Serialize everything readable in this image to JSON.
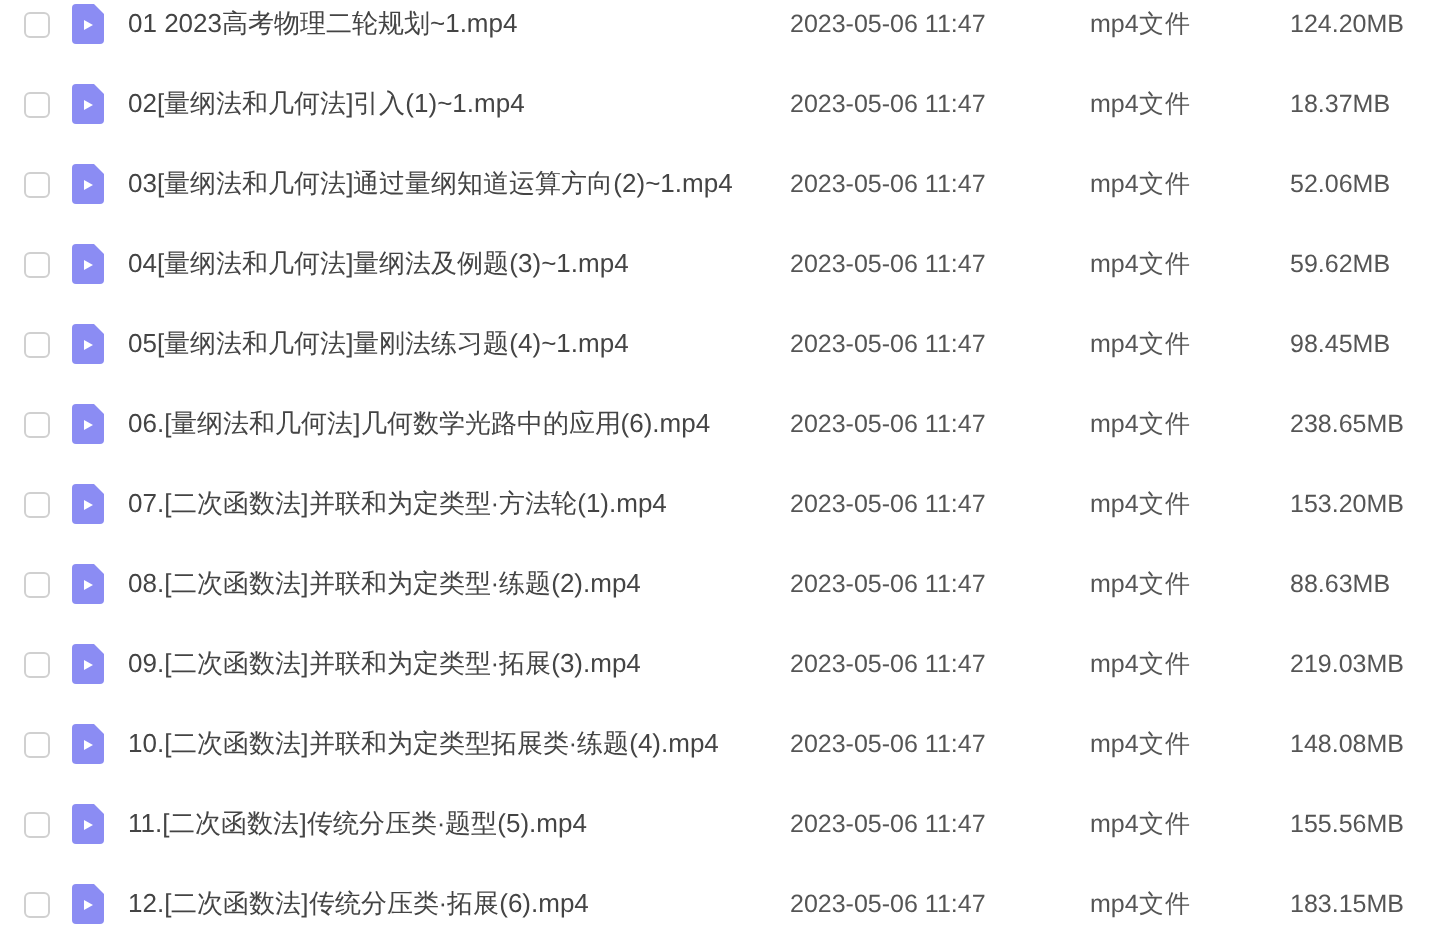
{
  "files": [
    {
      "name": "01 2023高考物理二轮规划~1.mp4",
      "modified": "2023-05-06 11:47",
      "type": "mp4文件",
      "size": "124.20MB",
      "checked": false
    },
    {
      "name": "02[量纲法和几何法]引入(1)~1.mp4",
      "modified": "2023-05-06 11:47",
      "type": "mp4文件",
      "size": "18.37MB",
      "checked": false
    },
    {
      "name": "03[量纲法和几何法]通过量纲知道运算方向(2)~1.mp4",
      "modified": "2023-05-06 11:47",
      "type": "mp4文件",
      "size": "52.06MB",
      "checked": false
    },
    {
      "name": "04[量纲法和几何法]量纲法及例题(3)~1.mp4",
      "modified": "2023-05-06 11:47",
      "type": "mp4文件",
      "size": "59.62MB",
      "checked": false
    },
    {
      "name": "05[量纲法和几何法]量刚法练习题(4)~1.mp4",
      "modified": "2023-05-06 11:47",
      "type": "mp4文件",
      "size": "98.45MB",
      "checked": false
    },
    {
      "name": "06.[量纲法和几何法]几何数学光路中的应用(6).mp4",
      "modified": "2023-05-06 11:47",
      "type": "mp4文件",
      "size": "238.65MB",
      "checked": false
    },
    {
      "name": "07.[二次函数法]并联和为定类型·方法轮(1).mp4",
      "modified": "2023-05-06 11:47",
      "type": "mp4文件",
      "size": "153.20MB",
      "checked": false
    },
    {
      "name": "08.[二次函数法]并联和为定类型·练题(2).mp4",
      "modified": "2023-05-06 11:47",
      "type": "mp4文件",
      "size": "88.63MB",
      "checked": false
    },
    {
      "name": "09.[二次函数法]并联和为定类型·拓展(3).mp4",
      "modified": "2023-05-06 11:47",
      "type": "mp4文件",
      "size": "219.03MB",
      "checked": false
    },
    {
      "name": "10.[二次函数法]并联和为定类型拓展类·练题(4).mp4",
      "modified": "2023-05-06 11:47",
      "type": "mp4文件",
      "size": "148.08MB",
      "checked": false
    },
    {
      "name": "11.[二次函数法]传统分压类·题型(5).mp4",
      "modified": "2023-05-06 11:47",
      "type": "mp4文件",
      "size": "155.56MB",
      "checked": false
    },
    {
      "name": "12.[二次函数法]传统分压类·拓展(6).mp4",
      "modified": "2023-05-06 11:47",
      "type": "mp4文件",
      "size": "183.15MB",
      "checked": false
    }
  ]
}
